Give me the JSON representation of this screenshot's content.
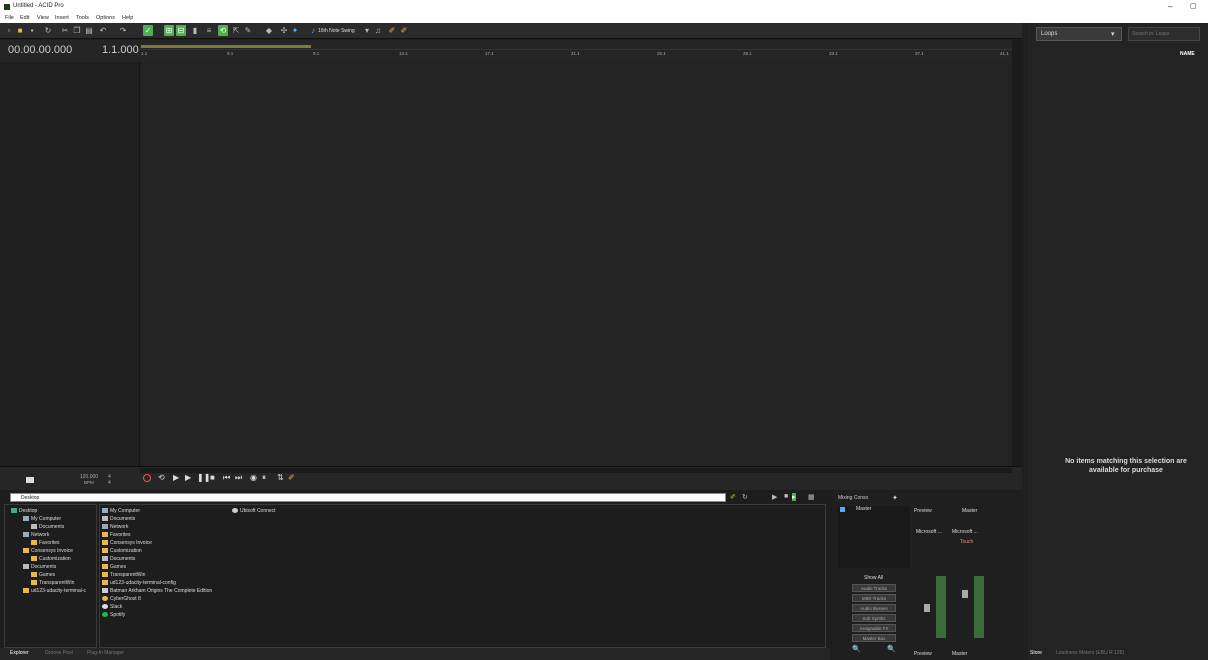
{
  "window": {
    "title": "Untitled - ACID Pro",
    "minimize": "–",
    "restore": "▢"
  },
  "menu": [
    "File",
    "Edit",
    "View",
    "Insert",
    "Tools",
    "Options",
    "Help"
  ],
  "toolbar": {
    "swing": "16th Note Swing"
  },
  "timeline": {
    "time": "00.00.00.000",
    "beat": "1.1.000",
    "ticks": [
      "1.1",
      "9.1",
      "9.1",
      "13.1",
      "17.1",
      "21.1",
      "25.1",
      "29.1",
      "33.1",
      "37.1",
      "41.1"
    ]
  },
  "transport": {
    "tempo": "120.000",
    "tempo_unit": "BPM",
    "sig_top": "4",
    "sig_bottom": "4"
  },
  "right": {
    "dropdown": "Loops",
    "search_placeholder": "Search in: Loops",
    "col_name": "NAME",
    "empty": "No items matching this selection are available for purchase",
    "tab_store": "Store",
    "tab_meters": "Loudness Meters (EBU R 128)"
  },
  "explorer": {
    "path": "Desktop",
    "tree": [
      {
        "label": "Desktop",
        "indent": 0
      },
      {
        "label": "My Computer",
        "indent": 1
      },
      {
        "label": "Documents",
        "indent": 2
      },
      {
        "label": "Network",
        "indent": 1
      },
      {
        "label": "Favorites",
        "indent": 2
      },
      {
        "label": "Consensys Invoice",
        "indent": 1
      },
      {
        "label": "Customization",
        "indent": 2
      },
      {
        "label": "Documents",
        "indent": 1
      },
      {
        "label": "Games",
        "indent": 2
      },
      {
        "label": "TransparentWin",
        "indent": 2
      },
      {
        "label": "ud123-udacity-terminal-c",
        "indent": 1
      }
    ],
    "list": [
      "My Computer",
      "Documents",
      "Network",
      "Favorites",
      "Consensys Invoice",
      "Customization",
      "Documents",
      "Games",
      "TransparentWin",
      "ud123-udacity-terminal-config",
      "Batman Arkham Origins The Complete Edition",
      "CyberGhost 8",
      "Slack",
      "Spotify"
    ],
    "list2": [
      "Ubisoft Connect"
    ]
  },
  "tabs": {
    "explorer": "Explorer",
    "groove": "Groove Pool",
    "plugin": "Plug-In Manager"
  },
  "mixer": {
    "title": "Mixing Conso",
    "master": "Master",
    "show_all": "Show All",
    "buttons": [
      "Audio Tracks",
      "MIDI Tracks",
      "Audio Busses",
      "Soft Synths",
      "Assignable FX",
      "Master Bus"
    ],
    "preview": "Preview",
    "microsoft1": "Microsoft ...",
    "microsoft2": "Microsoft ...",
    "touch": "Touch",
    "col_preview": "Preview",
    "col_master": "Master"
  }
}
